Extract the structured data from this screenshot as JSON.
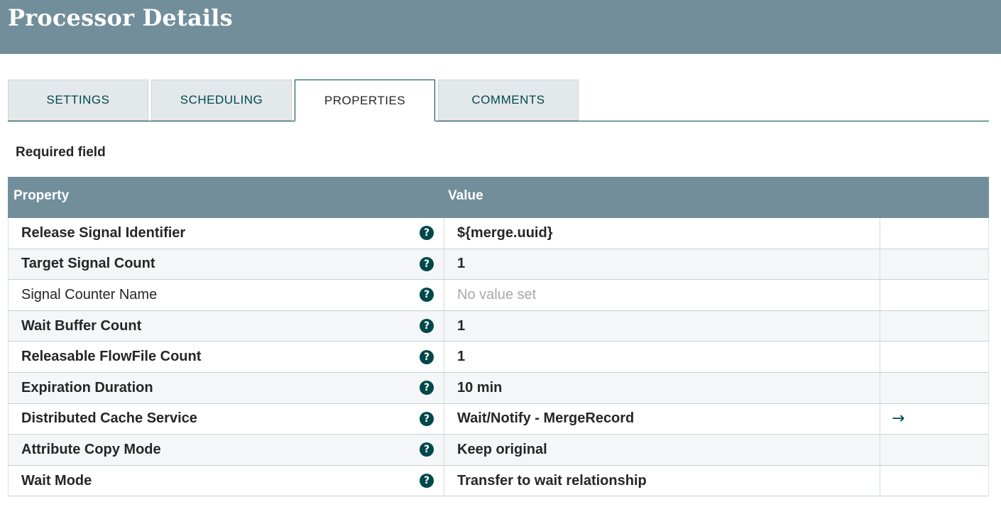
{
  "header": {
    "title": "Processor Details"
  },
  "tabs": [
    {
      "label": "SETTINGS",
      "active": false
    },
    {
      "label": "SCHEDULING",
      "active": false
    },
    {
      "label": "PROPERTIES",
      "active": true
    },
    {
      "label": "COMMENTS",
      "active": false
    }
  ],
  "required_note": "Required field",
  "grid": {
    "columns": {
      "property": "Property",
      "value": "Value"
    },
    "rows": [
      {
        "property": "Release Signal Identifier",
        "value": "${merge.uuid}",
        "required": true,
        "value_set": true,
        "has_goto": false
      },
      {
        "property": "Target Signal Count",
        "value": "1",
        "required": true,
        "value_set": true,
        "has_goto": false
      },
      {
        "property": "Signal Counter Name",
        "value": "No value set",
        "required": false,
        "value_set": false,
        "has_goto": false
      },
      {
        "property": "Wait Buffer Count",
        "value": "1",
        "required": true,
        "value_set": true,
        "has_goto": false
      },
      {
        "property": "Releasable FlowFile Count",
        "value": "1",
        "required": true,
        "value_set": true,
        "has_goto": false
      },
      {
        "property": "Expiration Duration",
        "value": "10 min",
        "required": true,
        "value_set": true,
        "has_goto": false
      },
      {
        "property": "Distributed Cache Service",
        "value": "Wait/Notify - MergeRecord",
        "required": true,
        "value_set": true,
        "has_goto": true
      },
      {
        "property": "Attribute Copy Mode",
        "value": "Keep original",
        "required": true,
        "value_set": true,
        "has_goto": false
      },
      {
        "property": "Wait Mode",
        "value": "Transfer to wait relationship",
        "required": true,
        "value_set": true,
        "has_goto": false
      }
    ]
  },
  "icons": {
    "help": "help-circle-icon",
    "goto": "arrow-right-icon"
  },
  "colors": {
    "header_bg": "#728e9b",
    "accent": "#004849",
    "tab_bg": "#e3e8eb"
  }
}
